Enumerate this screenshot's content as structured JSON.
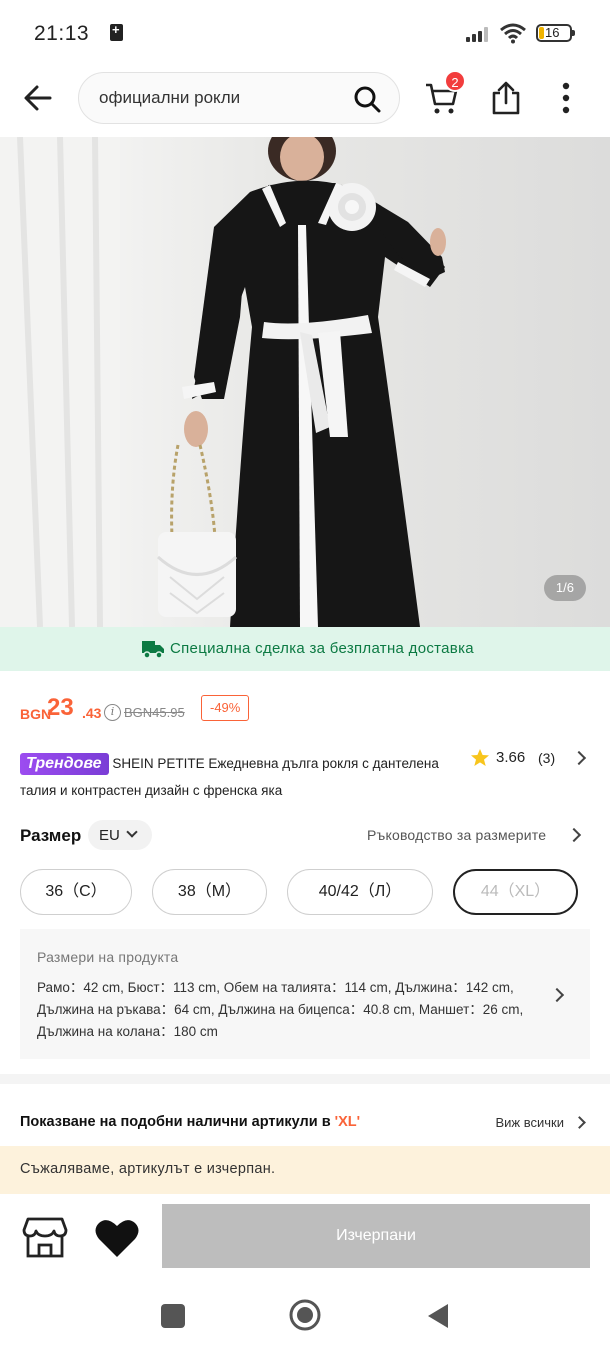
{
  "status_bar": {
    "time": "21:13",
    "battery": "16"
  },
  "header": {
    "search_query": "официални рокли",
    "cart_count": "2"
  },
  "gallery": {
    "counter": "1/6"
  },
  "shipping_banner": {
    "text": "Специална сделка за безплатна доставка"
  },
  "price": {
    "currency": "BGN",
    "integer": "23",
    "decimal": ".43",
    "original": "BGN45.95",
    "discount": "-49%"
  },
  "product": {
    "trend_badge": "Трендове",
    "title": "SHEIN PETITE Ежедневна дълга рокля с дантелена талия и контрастен дизайн с френска яка",
    "rating": "3.66",
    "review_count": "(3)"
  },
  "size": {
    "label": "Размер",
    "region": "EU",
    "guide": "Ръководство за размерите",
    "options": [
      {
        "label": "36（С）",
        "available": true
      },
      {
        "label": "38（М）",
        "available": true
      },
      {
        "label": "40/42（Л）",
        "available": true
      },
      {
        "label": "44（XL）",
        "available": false
      }
    ]
  },
  "measurements": {
    "title": "Размери на продукта",
    "text": "Рамо：42 cm, Бюст：113 cm, Обем на талията：114 cm, Дължина：142 cm, Дължина на ръкава：64 cm, Дължина на бицепса：40.8 cm, Маншет：26 cm, Дължина на колана：180 cm"
  },
  "similar": {
    "prefix": "Показване на подобни налични артикули в ",
    "size": "'XL'",
    "view_all": "Виж всички"
  },
  "sold_out_notice": "Съжаляваме, артикулът е изчерпан.",
  "bottom_bar": {
    "button_label": "Изчерпани"
  },
  "colors": {
    "accent": "#fa6338",
    "green": "#0c7a43",
    "badge_red": "#f23d3d"
  }
}
